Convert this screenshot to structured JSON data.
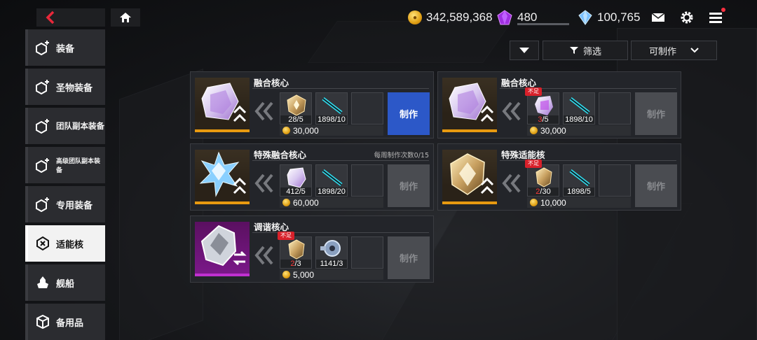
{
  "currency": {
    "gold": "342,589,368",
    "gem": "480",
    "crystal": "100,765"
  },
  "nav": [
    {
      "label": "装备",
      "active": false
    },
    {
      "label": "圣物装备",
      "active": false
    },
    {
      "label": "团队副本装备",
      "active": false
    },
    {
      "label": "高级团队副本装备",
      "active": false
    },
    {
      "label": "专用装备",
      "active": false
    },
    {
      "label": "适能核",
      "active": true
    },
    {
      "label": "舰船",
      "active": false
    },
    {
      "label": "备用品",
      "active": false
    }
  ],
  "filters": {
    "filter_label": "筛选",
    "craftable_label": "可制作"
  },
  "cards": [
    {
      "title": "融合核心",
      "mat1": {
        "have": "28",
        "need": "/5",
        "lack": false
      },
      "mat2": "1898/10",
      "cost": "30,000",
      "make": "制作",
      "enabled": true,
      "weekly": ""
    },
    {
      "title": "融合核心",
      "mat1": {
        "have": "3",
        "need": "/5",
        "lack": true
      },
      "mat2": "1898/10",
      "cost": "30,000",
      "make": "制作",
      "enabled": false,
      "weekly": ""
    },
    {
      "title": "特殊融合核心",
      "mat1": {
        "have": "412",
        "need": "/5",
        "lack": false
      },
      "mat2": "1898/20",
      "cost": "60,000",
      "make": "制作",
      "enabled": false,
      "weekly": "每周制作次数0/15"
    },
    {
      "title": "特殊适能核",
      "mat1": {
        "have": "2",
        "need": "/30",
        "lack": true
      },
      "mat2": "1898/5",
      "cost": "10,000",
      "make": "制作",
      "enabled": false,
      "weekly": ""
    },
    {
      "title": "调谐核心",
      "mat1": {
        "have": "2",
        "need": "/3",
        "lack": true
      },
      "mat2": "1141/3",
      "cost": "5,000",
      "make": "制作",
      "enabled": false,
      "weekly": ""
    }
  ],
  "lack_label": "不足",
  "colors": {
    "accent_blue": "#2c58c8",
    "lack_red": "#d8202a",
    "gold_border": "#e89a10",
    "back_red": "#e8283a"
  }
}
